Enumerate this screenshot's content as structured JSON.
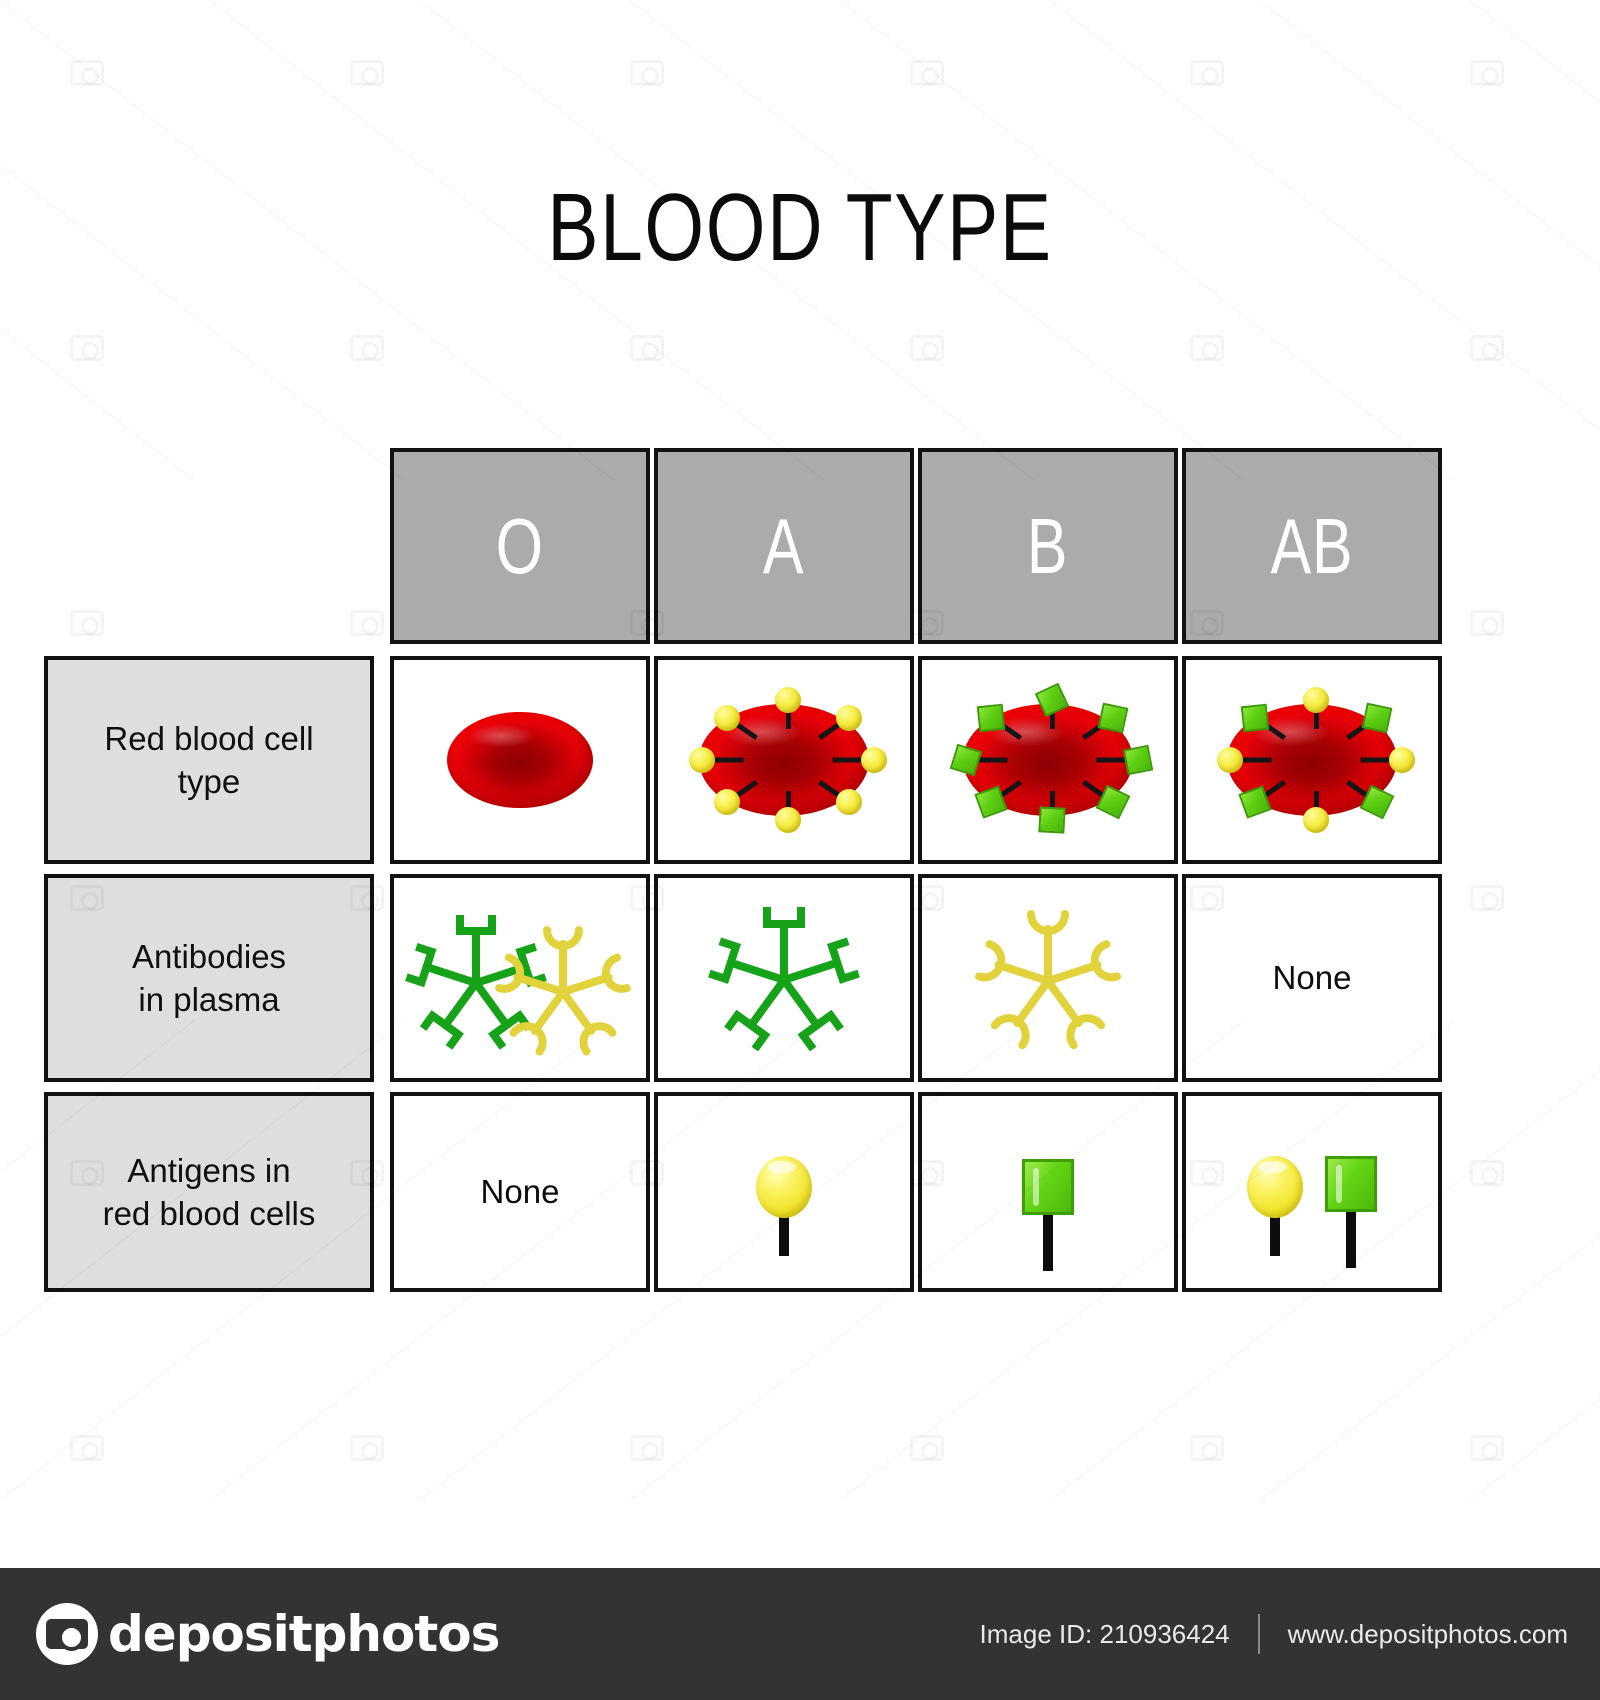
{
  "title": "BLOOD TYPE",
  "table": {
    "column_headers": [
      {
        "label": "O"
      },
      {
        "label": "A"
      },
      {
        "label": "B"
      },
      {
        "label": "AB"
      }
    ],
    "row_labels": [
      {
        "line1": "Red blood cell",
        "line2": "type"
      },
      {
        "line1": "Antibodies",
        "line2": "in plasma"
      },
      {
        "line1": "Antigens in",
        "line2": "red blood cells"
      }
    ],
    "rows": [
      {
        "name": "red-blood-cell-type",
        "cells": [
          {
            "column": "O",
            "kind": "cell-plain",
            "antigens": "none",
            "text": ""
          },
          {
            "column": "A",
            "kind": "cell-yellow-antigens",
            "antigens": "yellow-circles",
            "text": ""
          },
          {
            "column": "B",
            "kind": "cell-green-antigens",
            "antigens": "green-squares",
            "text": ""
          },
          {
            "column": "AB",
            "kind": "cell-both-antigens",
            "antigens": "yellow-circles-and-green-squares",
            "text": ""
          }
        ]
      },
      {
        "name": "antibodies-in-plasma",
        "cells": [
          {
            "column": "O",
            "kind": "antibodies",
            "antibodies": "anti-A-green-and-anti-B-yellow",
            "text": ""
          },
          {
            "column": "A",
            "kind": "antibodies",
            "antibodies": "anti-B-green",
            "text": ""
          },
          {
            "column": "B",
            "kind": "antibodies",
            "antibodies": "anti-A-yellow",
            "text": ""
          },
          {
            "column": "AB",
            "kind": "text",
            "antibodies": "none",
            "text": "None"
          }
        ]
      },
      {
        "name": "antigens-in-red-blood-cells",
        "cells": [
          {
            "column": "O",
            "kind": "text",
            "antigen_pins": "none",
            "text": "None"
          },
          {
            "column": "A",
            "kind": "pins",
            "antigen_pins": "yellow-ball-pin",
            "text": ""
          },
          {
            "column": "B",
            "kind": "pins",
            "antigen_pins": "green-square-pin",
            "text": ""
          },
          {
            "column": "AB",
            "kind": "pins",
            "antigen_pins": "yellow-ball-pin-and-green-square-pin",
            "text": ""
          }
        ]
      }
    ]
  },
  "colors": {
    "header_gray": "#ABABAB",
    "row_label_gray": "#DEDEDE",
    "border_black": "#111111",
    "rbc_red": "#EE0000",
    "rbc_dark_red": "#8D0002",
    "antigen_yellow": "#F2E42C",
    "antigen_green": "#5ECF12",
    "antibody_green": "#17A319",
    "antibody_yellow": "#E2D23C",
    "footer_bar": "#333333"
  },
  "footer": {
    "brand": "depositphotos",
    "image_id": "Image ID: 210936424",
    "website": "www.depositphotos.com"
  }
}
